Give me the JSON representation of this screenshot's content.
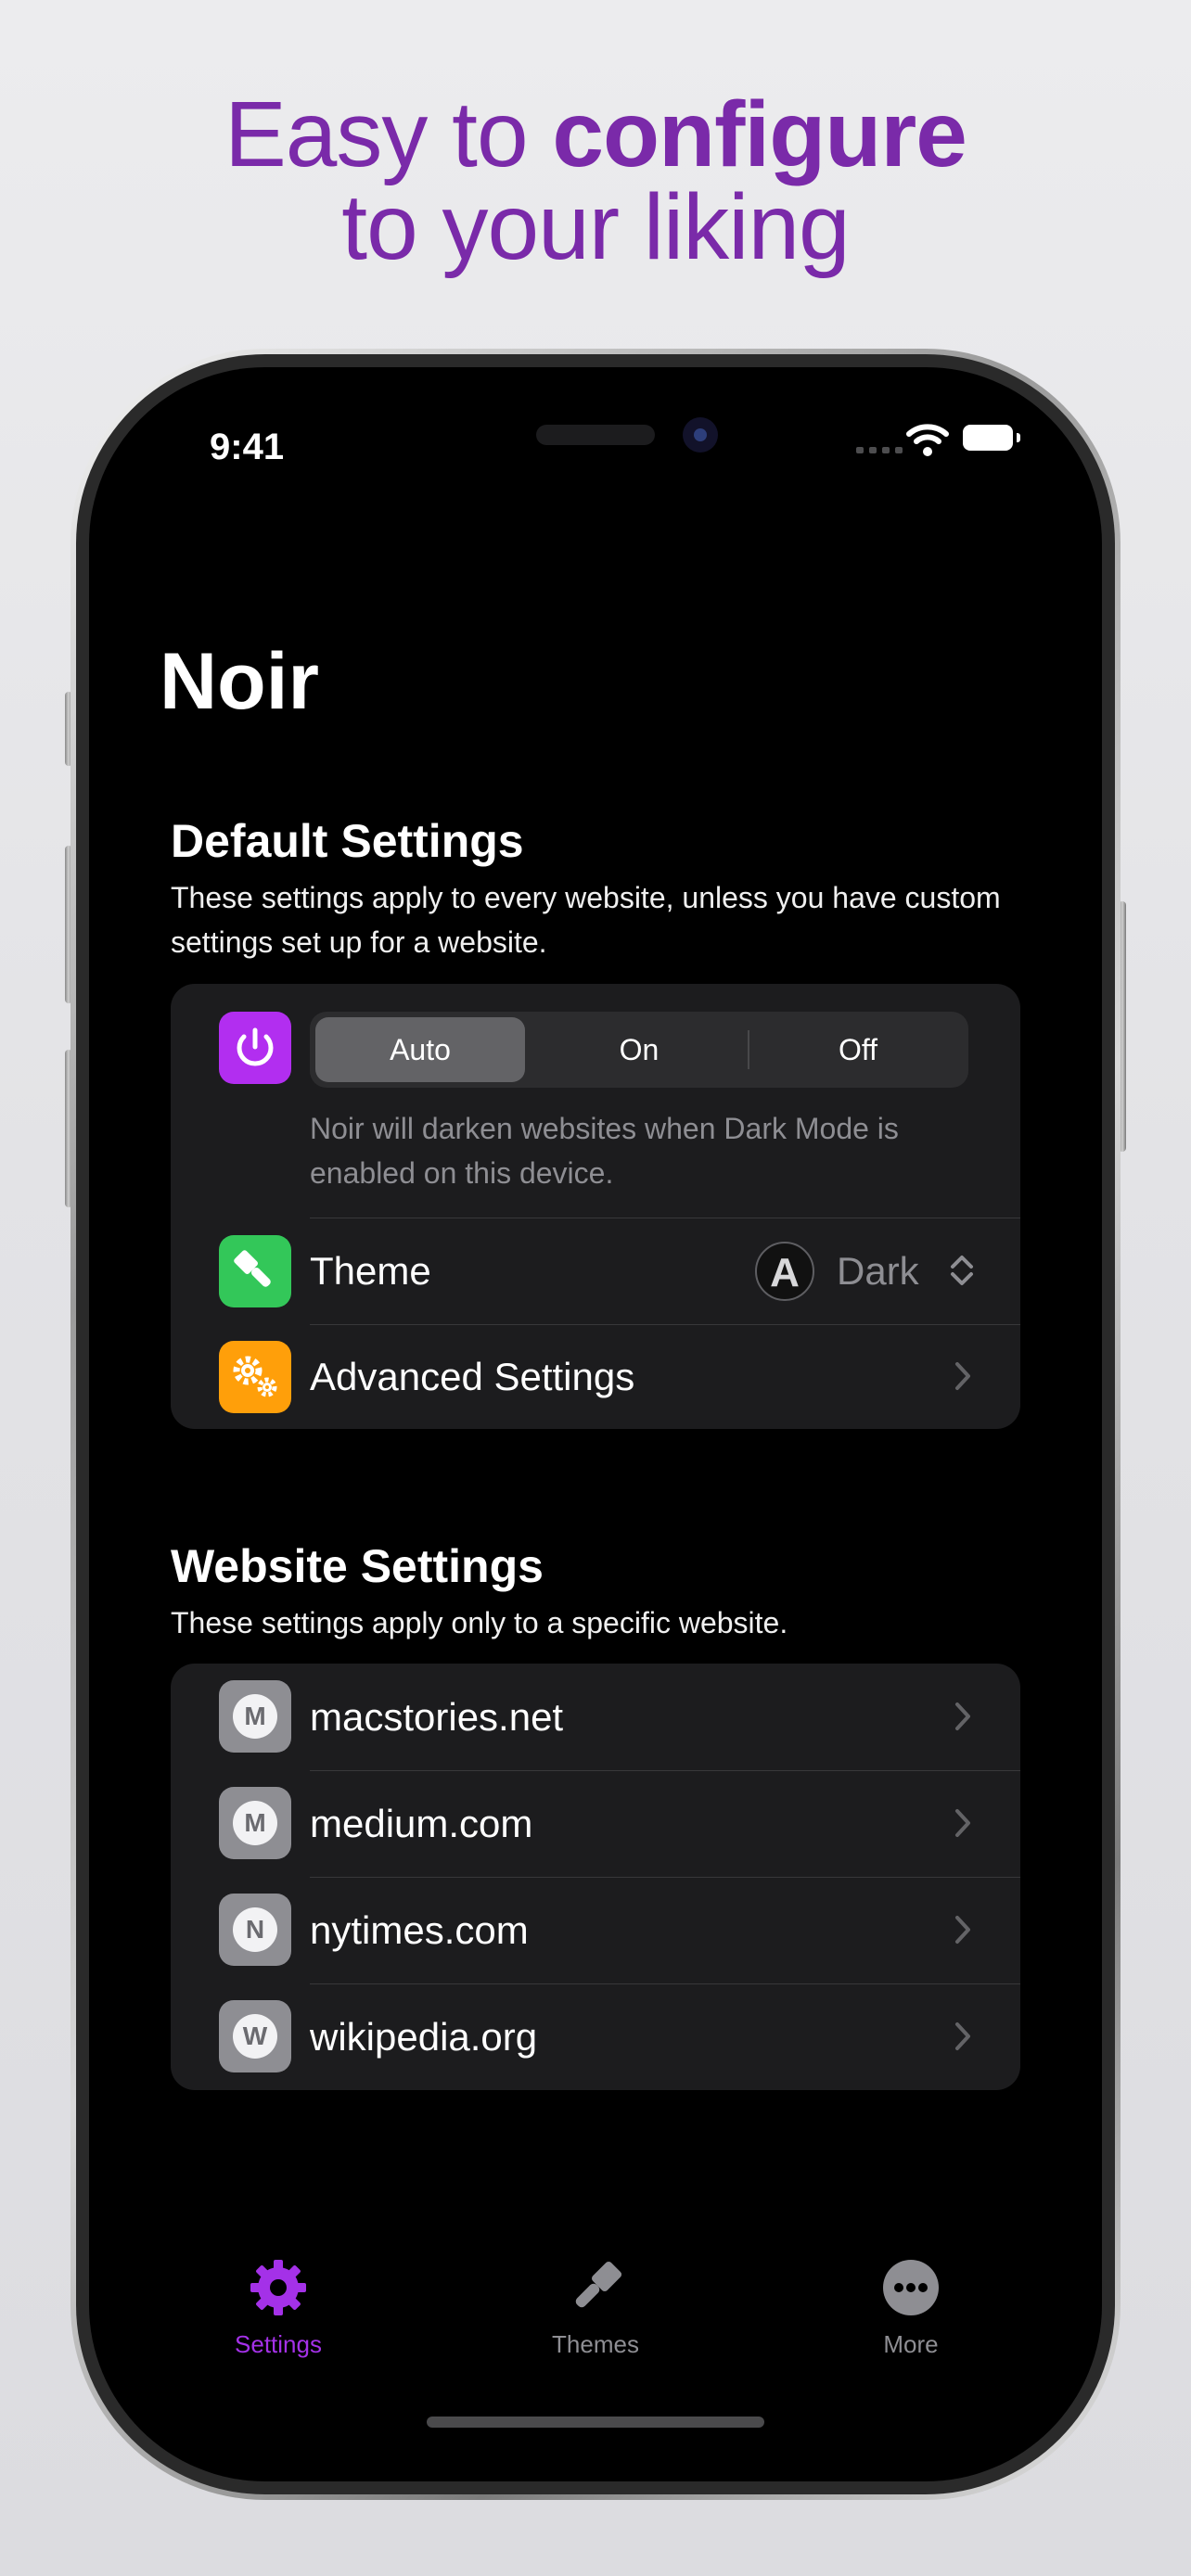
{
  "headline": {
    "line1_regular": "Easy to ",
    "line1_bold": "configure",
    "line2": "to your liking",
    "color": "#7a2aa9"
  },
  "status_bar": {
    "time": "9:41"
  },
  "app": {
    "title": "Noir"
  },
  "default_settings": {
    "title": "Default Settings",
    "description": "These settings apply to every website, unless you have custom settings set up for a website.",
    "power_icon": "power-icon",
    "power_icon_color": "#b22ef0",
    "mode_options": [
      "Auto",
      "On",
      "Off"
    ],
    "selected_mode": "Auto",
    "mode_hint": "Noir will darken websites when Dark Mode is enabled on this device.",
    "theme": {
      "label": "Theme",
      "icon": "paintbrush-icon",
      "icon_color": "#33c759",
      "badge_letter": "A",
      "value": "Dark"
    },
    "advanced": {
      "label": "Advanced Settings",
      "icon": "gears-icon",
      "icon_color": "#ff9f0a"
    }
  },
  "website_settings": {
    "title": "Website Settings",
    "description": "These settings apply only to a specific website.",
    "sites": [
      {
        "letter": "M",
        "name": "macstories.net"
      },
      {
        "letter": "M",
        "name": "medium.com"
      },
      {
        "letter": "N",
        "name": "nytimes.com"
      },
      {
        "letter": "W",
        "name": "wikipedia.org"
      }
    ]
  },
  "tab_bar": {
    "active_color": "#a431e8",
    "inactive_color": "#8e8e93",
    "tabs": [
      {
        "label": "Settings",
        "icon": "gear-icon",
        "active": true
      },
      {
        "label": "Themes",
        "icon": "paintbrush-icon",
        "active": false
      },
      {
        "label": "More",
        "icon": "ellipsis-circle-icon",
        "active": false
      }
    ]
  }
}
